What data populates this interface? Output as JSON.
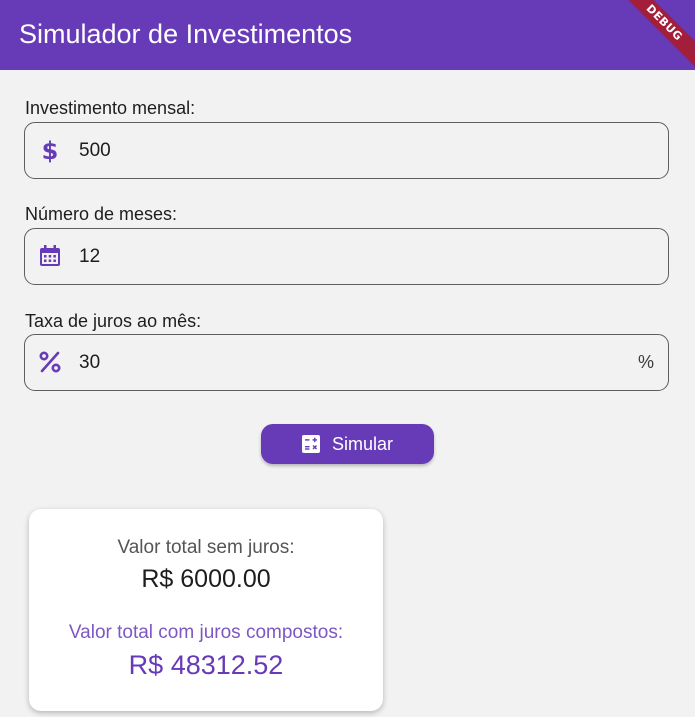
{
  "app_bar": {
    "title": "Simulador de Investimentos",
    "debug_banner": "DEBUG",
    "color": "#673ab7"
  },
  "form": {
    "monthly_investment": {
      "label": "Investimento mensal:",
      "value": "500",
      "icon": "dollar-icon"
    },
    "months": {
      "label": "Número de meses:",
      "value": "12",
      "icon": "calendar-icon"
    },
    "interest_rate": {
      "label": "Taxa de juros ao mês:",
      "value": "30",
      "suffix": "%",
      "icon": "percent-icon"
    }
  },
  "simulate_button": {
    "label": "Simular",
    "icon": "calculator-icon"
  },
  "results": {
    "without_interest_label": "Valor total sem juros:",
    "without_interest_value": "R$ 6000.00",
    "with_interest_label": "Valor total com juros compostos:",
    "with_interest_value": "R$ 48312.52",
    "accent_color": "#673ab7"
  }
}
